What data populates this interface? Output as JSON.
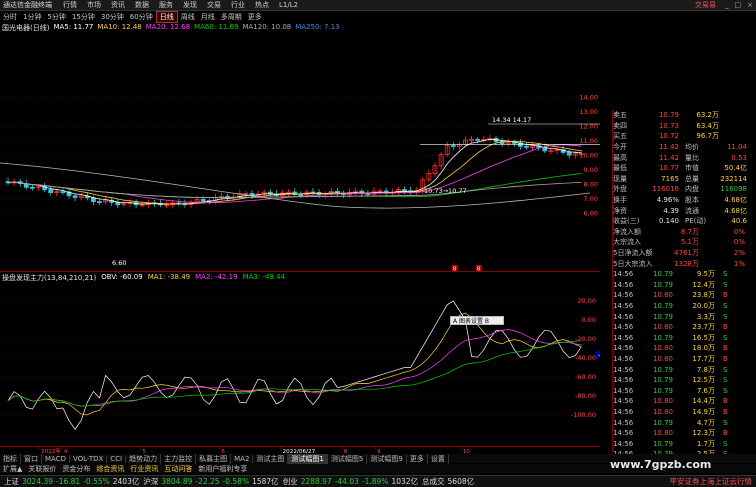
{
  "menubar": {
    "app_title": "通达信金融终端",
    "items": [
      "行情",
      "市场",
      "资讯",
      "数据",
      "服务",
      "发现",
      "交易",
      "行业",
      "热点",
      "L1/L2"
    ],
    "trade_label": "交易易",
    "window_buttons": [
      "_",
      "□",
      "×"
    ]
  },
  "periods": {
    "items": [
      "分时",
      "1分钟",
      "5分钟",
      "15分钟",
      "30分钟",
      "60分钟",
      "日线",
      "周线",
      "月线",
      "多周期",
      "更多"
    ],
    "selected": "日线"
  },
  "ma_legend": {
    "stock": "国光电器(日线)",
    "items": [
      {
        "label": "MA5: 11.77",
        "color": "#ffffff"
      },
      {
        "label": "MA10: 12.48",
        "color": "#ffd23f"
      },
      {
        "label": "MA20: 12.68",
        "color": "#ff40ff"
      },
      {
        "label": "MA60: 11.69",
        "color": "#00d000"
      },
      {
        "label": "MA120: 10.08",
        "color": "#aaaaaa"
      },
      {
        "label": "MA250: 7.13",
        "color": "#3a8de0"
      }
    ]
  },
  "price_axis": [
    "14.00",
    "13.00",
    "12.00",
    "11.00",
    "10.00",
    "9.00",
    "8.00",
    "7.00",
    "6.00"
  ],
  "price_annotations": {
    "high": "14.34 14.17",
    "low": "6.60",
    "mid": "10.73→10.77",
    "box_labels": [
      "B",
      "B"
    ]
  },
  "ind_legend": {
    "title": "操盘发现主力(13,84,210,21)",
    "items": [
      {
        "label": "OBV: -60.09",
        "color": "#ffffff"
      },
      {
        "label": "MA1: -38.49",
        "color": "#ffd23f"
      },
      {
        "label": "MA2: -42.19",
        "color": "#ff40ff"
      },
      {
        "label": "MA3: -49.44",
        "color": "#00d000"
      }
    ]
  },
  "ind_axis": [
    "20.00",
    "0.00",
    "-20.00",
    "-40.00",
    "-60.00",
    "-80.00",
    "-100.00"
  ],
  "ind_current": "-0.98",
  "selbox_label": "A 图表设置 B",
  "date_axis": {
    "labels": [
      "2022年",
      "4",
      "5",
      "6",
      "2022/06/27",
      "8",
      "9",
      "10"
    ]
  },
  "quote": {
    "asks": [
      [
        "卖五",
        "10.79",
        "63.2万"
      ],
      [
        "卖四",
        "10.73",
        "63.4万"
      ],
      [
        "买五",
        "10.72",
        "96.7万"
      ]
    ],
    "stats": [
      [
        "今开",
        "11.42",
        "均价",
        "11.04"
      ],
      [
        "最高",
        "11.42",
        "量比",
        "0.53"
      ],
      [
        "最低",
        "10.77",
        "市值",
        "50.4亿"
      ],
      [
        "现量",
        "7165",
        "总量",
        "232114"
      ],
      [
        "外盘",
        "116016",
        "内盘",
        "116098"
      ],
      [
        "换手",
        "4.96%",
        "股本",
        "4.68亿"
      ],
      [
        "净资",
        "4.39",
        "流通",
        "4.68亿"
      ],
      [
        "收益(三)",
        "0.140",
        "PE(动)",
        "40.6"
      ]
    ],
    "flows": [
      [
        "净流入额",
        "8.7万",
        "0%"
      ],
      [
        "大宗流入",
        "5.1万",
        "0%"
      ],
      [
        "5日净流入额",
        "4761万",
        "2%"
      ],
      [
        "5日大宗流入",
        "1328万",
        "1%"
      ]
    ],
    "ticks": [
      [
        "14:56",
        "10.79",
        "9.5万",
        "S"
      ],
      [
        "14:56",
        "10.79",
        "12.4万",
        "S"
      ],
      [
        "14:56",
        "10.80",
        "23.8万",
        "B"
      ],
      [
        "14:56",
        "10.79",
        "20.0万",
        "S"
      ],
      [
        "14:56",
        "10.79",
        "3.3万",
        "S"
      ],
      [
        "14:56",
        "10.80",
        "23.7万",
        "B"
      ],
      [
        "14:56",
        "10.79",
        "16.5万",
        "S"
      ],
      [
        "14:56",
        "10.80",
        "18.0万",
        "B"
      ],
      [
        "14:56",
        "10.80",
        "17.7万",
        "B"
      ],
      [
        "14:56",
        "10.79",
        "7.8万",
        "S"
      ],
      [
        "14:56",
        "10.79",
        "12.5万",
        "S"
      ],
      [
        "14:56",
        "10.79",
        "7.6万",
        "S"
      ],
      [
        "14:56",
        "10.80",
        "14.4万",
        "B"
      ],
      [
        "14:56",
        "10.80",
        "14.9万",
        "B"
      ],
      [
        "14:56",
        "10.79",
        "4.7万",
        "S"
      ],
      [
        "14:56",
        "10.80",
        "12.3万",
        "B"
      ],
      [
        "14:56",
        "10.79",
        "1.7万",
        "S"
      ],
      [
        "14:56",
        "10.79",
        "2.5万",
        "S"
      ]
    ]
  },
  "bottom_tabs": [
    "指标",
    "窗口",
    "MACD",
    "VOL-TDX",
    "CCI",
    "趋势动力",
    "主力监控",
    "私募主图",
    "MA2",
    "测试主图",
    "测试幅图1",
    "测试幅图5",
    "测试幅图9",
    "更多",
    "设置"
  ],
  "bottom_tabs_selected": "测试幅图1",
  "bottom_tabs2": [
    "扩展▲",
    "关联报价",
    "资金分布",
    "综合资讯",
    "行业资讯",
    "互动问答",
    "新用户福利专享"
  ],
  "statusbar": {
    "indices": [
      {
        "name": "上证",
        "val": "3024.39",
        "chg": "-16.81",
        "pct": "-0.55%",
        "amt": "2403亿"
      },
      {
        "name": "沪深",
        "val": "3804.89",
        "chg": "-22.25",
        "pct": "-0.58%",
        "amt": "1587亿"
      },
      {
        "name": "创业",
        "val": "2288.97",
        "chg": "-44.03",
        "pct": "-1.89%",
        "amt": "1032亿"
      }
    ],
    "extra_name": "总成交",
    "extra_val": "5608亿",
    "broker": "平安证券上海上证云行情"
  },
  "watermark": "www.7gpzb.com"
}
